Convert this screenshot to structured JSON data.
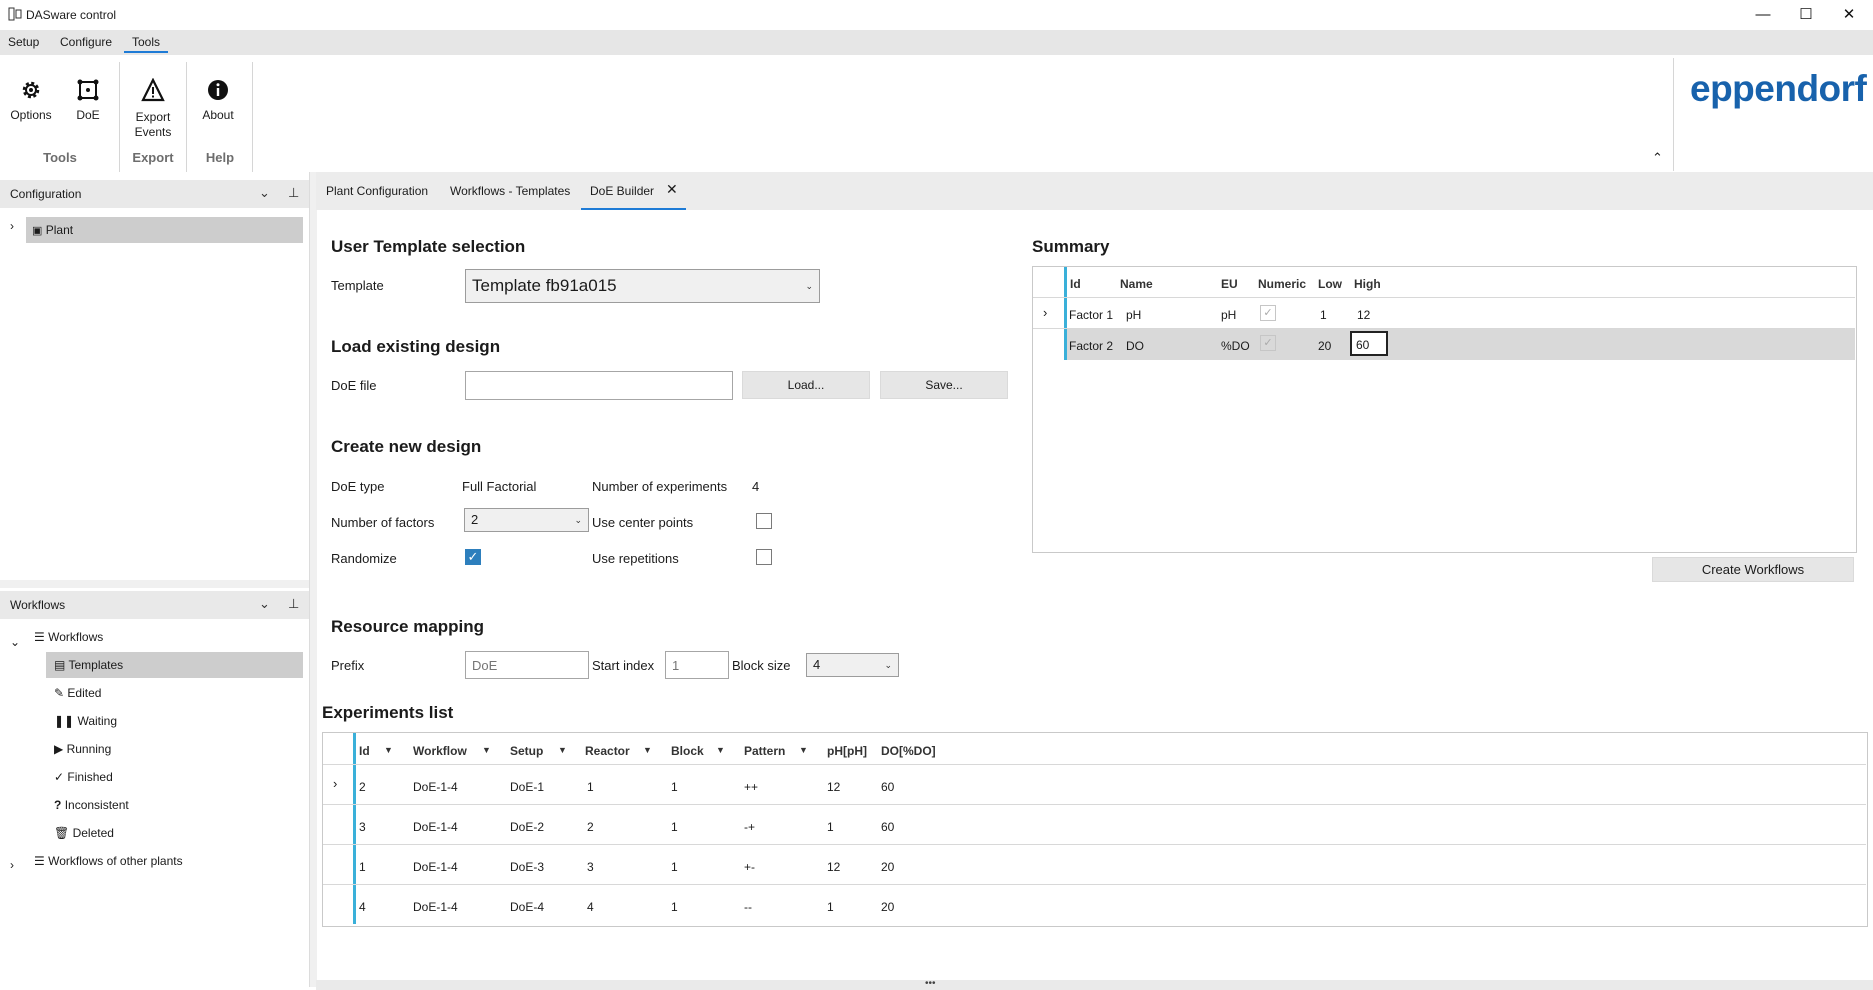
{
  "window": {
    "title": "DASware control",
    "minimize": "—",
    "maximize": "☐",
    "close": "✕"
  },
  "menu": {
    "setup": "Setup",
    "configure": "Configure",
    "tools": "Tools"
  },
  "ribbon": {
    "options": "Options",
    "doe": "DoE",
    "export_events_1": "Export",
    "export_events_2": "Events",
    "about": "About",
    "group_tools": "Tools",
    "group_export": "Export",
    "group_help": "Help",
    "collapse": "⌃",
    "logo": "eppendorf"
  },
  "config_pane": {
    "title": "Configuration",
    "plant": "Plant"
  },
  "workflows_pane": {
    "title": "Workflows",
    "root": "Workflows",
    "items": [
      "Templates",
      "Edited",
      "Waiting",
      "Running",
      "Finished",
      "Inconsistent",
      "Deleted"
    ],
    "other": "Workflows of other plants"
  },
  "tabs": [
    "Plant Configuration",
    "Workflows - Templates",
    "DoE Builder"
  ],
  "template_section": {
    "heading": "User Template selection",
    "label": "Template",
    "value": "Template fb91a015"
  },
  "load_section": {
    "heading": "Load existing design",
    "label": "DoE file",
    "value": "",
    "load": "Load...",
    "save": "Save..."
  },
  "create_section": {
    "heading": "Create new design",
    "doe_type_label": "DoE type",
    "doe_type_value": "Full Factorial",
    "num_exp_label": "Number of experiments",
    "num_exp_value": "4",
    "num_factors_label": "Number of factors",
    "num_factors_value": "2",
    "center_label": "Use center points",
    "randomize_label": "Randomize",
    "repetitions_label": "Use repetitions"
  },
  "resource_section": {
    "heading": "Resource mapping",
    "prefix_label": "Prefix",
    "prefix_placeholder": "DoE",
    "start_label": "Start index",
    "start_placeholder": "1",
    "block_label": "Block size",
    "block_value": "4"
  },
  "summary": {
    "heading": "Summary",
    "columns": [
      "Id",
      "Name",
      "EU",
      "Numeric",
      "Low",
      "High"
    ],
    "rows": [
      {
        "id": "Factor 1",
        "name": "pH",
        "eu": "pH",
        "low": "1",
        "high": "12"
      },
      {
        "id": "Factor 2",
        "name": "DO",
        "eu": "%DO",
        "low": "20",
        "high": "60"
      }
    ],
    "create_button": "Create Workflows"
  },
  "experiments": {
    "heading": "Experiments list",
    "columns": [
      "Id",
      "Workflow",
      "Setup",
      "Reactor",
      "Block",
      "Pattern",
      "pH[pH]",
      "DO[%DO]"
    ],
    "rows": [
      [
        "2",
        "DoE-1-4",
        "DoE-1",
        "1",
        "1",
        "++",
        "12",
        "60"
      ],
      [
        "3",
        "DoE-1-4",
        "DoE-2",
        "2",
        "1",
        "-+",
        "1",
        "60"
      ],
      [
        "1",
        "DoE-1-4",
        "DoE-3",
        "3",
        "1",
        "+-",
        "12",
        "20"
      ],
      [
        "4",
        "DoE-1-4",
        "DoE-4",
        "4",
        "1",
        "--",
        "1",
        "20"
      ]
    ]
  },
  "colors": {
    "accent": "#3ab0d9",
    "selection": "#cdcdcd",
    "brand": "#1862ac",
    "checkbox": "#2d7fbd"
  }
}
